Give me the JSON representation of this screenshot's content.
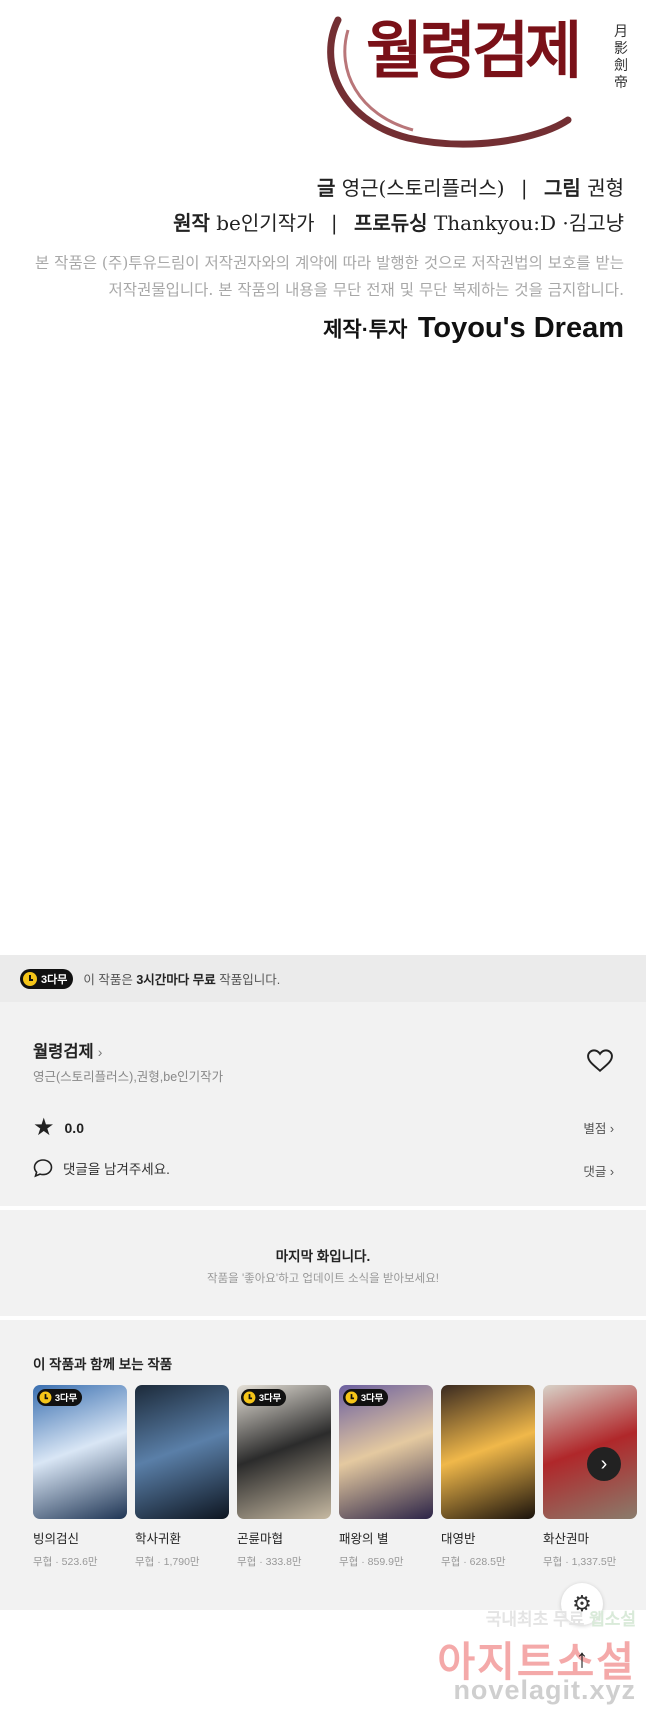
{
  "comic": {
    "logo_title": "월령검제",
    "logo_hanja": "月影劍帝",
    "credit_line1": {
      "writer_label": "글",
      "writer": "영근(스토리플러스)",
      "separator": "|",
      "artist_label": "그림",
      "artist": "권형"
    },
    "credit_line2": {
      "original_label": "원작",
      "original": "be인기작가",
      "separator": "|",
      "producer_label": "프로듀싱",
      "producer": "Thankyou:D ·김고냥"
    },
    "notice_line1": "본 작품은 (주)투유드림이 저작권자와의 계약에 따라 발행한 것으로 저작권법의 보호를 받는",
    "notice_line2": "저작권물입니다. 본 작품의 내용을 무단 전재 및 무단 복제하는 것을 금지합니다.",
    "production_label": "제작·투자",
    "production_brand": "Toyou's Dream"
  },
  "free_banner": {
    "badge": "3다무",
    "text_before": "이 작품은 ",
    "text_bold": "3시간마다 무료",
    "text_after": " 작품입니다."
  },
  "info": {
    "title": "월령검제",
    "title_chevron": "›",
    "authors": "영근(스토리플러스),권형,be인기작가",
    "heart_icon": "heart-icon",
    "rating": "0.0",
    "rate_link": "별점 ›",
    "comment_prompt": "댓글을 남겨주세요.",
    "comment_link": "댓글 ›"
  },
  "last_episode": {
    "title": "마지막 화입니다.",
    "subtitle": "작품을 '좋아요'하고 업데이트 소식을 받아보세요!"
  },
  "recommendations": {
    "heading": "이 작품과 함께 보는 작품",
    "items": [
      {
        "title": "빙의검신",
        "meta": "무협 · 523.6만",
        "badge": "3다무",
        "colors": [
          "#3a6fb0",
          "#d9e6f5",
          "#1f3554"
        ]
      },
      {
        "title": "학사귀환",
        "meta": "무협 · 1,790만",
        "badge": "",
        "colors": [
          "#1c2a3a",
          "#5a7fa8",
          "#0d1520"
        ]
      },
      {
        "title": "곤륜마협",
        "meta": "무협 · 333.8만",
        "badge": "3다무",
        "colors": [
          "#e6e1d8",
          "#2b2b2b",
          "#c6b9a2"
        ]
      },
      {
        "title": "패왕의 별",
        "meta": "무협 · 859.9만",
        "badge": "3다무",
        "colors": [
          "#6b5fa0",
          "#e4c9a0",
          "#2c2448"
        ]
      },
      {
        "title": "대영반",
        "meta": "무협 · 628.5만",
        "badge": "",
        "colors": [
          "#3a2a20",
          "#f0b84a",
          "#1a120c"
        ]
      },
      {
        "title": "화산권마",
        "meta": "무협 · 1,337.5만",
        "badge": "",
        "colors": [
          "#d8d2c8",
          "#b0272a",
          "#8a7c6c"
        ]
      }
    ],
    "next_icon": "chevron-right-icon"
  },
  "floating": {
    "settings_glyph": "⚙",
    "top_glyph": "↑"
  },
  "watermark": {
    "line1_a": "국내최초 무료 ",
    "line1_b": "웹소설",
    "line2": "아지트소설",
    "line3": "novelagit.xyz"
  },
  "colors": {
    "logo_red": "#7a1118",
    "badge_yellow": "#f5c518",
    "panel_gray": "#f2f2f2"
  }
}
